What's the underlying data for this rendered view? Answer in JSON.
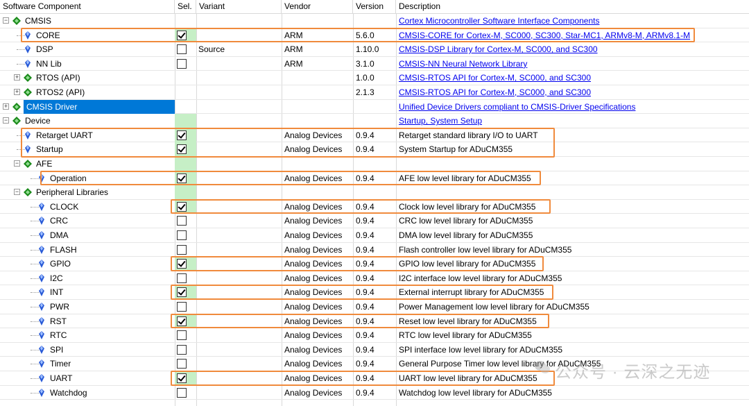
{
  "header": {
    "component": "Software Component",
    "sel": "Sel.",
    "variant": "Variant",
    "vendor": "Vendor",
    "version": "Version",
    "description": "Description"
  },
  "rows": [
    {
      "name": "CMSIS",
      "level": 0,
      "toggle": "-",
      "icon": "diamond-icon",
      "checkbox": false,
      "sel_state": "none",
      "variant": "",
      "vendor": "",
      "version": "",
      "desc": "Cortex Microcontroller Software Interface Components",
      "link": true,
      "green": false,
      "highlight": false,
      "selected": false
    },
    {
      "name": "CORE",
      "level": 1,
      "toggle": "",
      "icon": "gem-icon",
      "checkbox": true,
      "sel_state": "checked",
      "variant": "",
      "vendor": "ARM",
      "version": "5.6.0",
      "desc": "CMSIS-CORE for Cortex-M, SC000, SC300, Star-MC1, ARMv8-M, ARMv8.1-M",
      "link": true,
      "green": true,
      "highlight": true,
      "selected": false
    },
    {
      "name": "DSP",
      "level": 1,
      "toggle": "",
      "icon": "gem-icon",
      "checkbox": true,
      "sel_state": "unchecked",
      "variant": "Source",
      "vendor": "ARM",
      "version": "1.10.0",
      "desc": "CMSIS-DSP Library for Cortex-M, SC000, and SC300",
      "link": true,
      "green": false,
      "highlight": false,
      "selected": false
    },
    {
      "name": "NN Lib",
      "level": 1,
      "toggle": "",
      "icon": "gem-icon",
      "checkbox": true,
      "sel_state": "unchecked",
      "variant": "",
      "vendor": "ARM",
      "version": "3.1.0",
      "desc": "CMSIS-NN Neural Network Library",
      "link": true,
      "green": false,
      "highlight": false,
      "selected": false
    },
    {
      "name": "RTOS (API)",
      "level": 1,
      "toggle": "+",
      "icon": "diamond-icon",
      "checkbox": false,
      "sel_state": "none",
      "variant": "",
      "vendor": "",
      "version": "1.0.0",
      "desc": "CMSIS-RTOS API for Cortex-M, SC000, and SC300",
      "link": true,
      "green": false,
      "highlight": false,
      "selected": false
    },
    {
      "name": "RTOS2 (API)",
      "level": 1,
      "toggle": "+",
      "icon": "diamond-icon",
      "checkbox": false,
      "sel_state": "none",
      "variant": "",
      "vendor": "",
      "version": "2.1.3",
      "desc": "CMSIS-RTOS API for Cortex-M, SC000, and SC300",
      "link": true,
      "green": false,
      "highlight": false,
      "selected": false
    },
    {
      "name": "CMSIS Driver",
      "level": 0,
      "toggle": "+",
      "icon": "diamond-icon",
      "checkbox": false,
      "sel_state": "none",
      "variant": "",
      "vendor": "",
      "version": "",
      "desc": "Unified Device Drivers compliant to CMSIS-Driver Specifications",
      "link": true,
      "green": false,
      "highlight": false,
      "selected": true
    },
    {
      "name": "Device",
      "level": 0,
      "toggle": "-",
      "icon": "diamond-icon",
      "checkbox": false,
      "sel_state": "none",
      "variant": "",
      "vendor": "",
      "version": "",
      "desc": "Startup, System Setup",
      "link": true,
      "green": true,
      "highlight": false,
      "selected": false
    },
    {
      "name": "Retarget UART",
      "level": 1,
      "toggle": "",
      "icon": "gem-icon",
      "checkbox": true,
      "sel_state": "checked",
      "variant": "",
      "vendor": "Analog Devices",
      "version": "0.9.4",
      "desc": "Retarget standard library I/O to UART",
      "link": false,
      "green": true,
      "highlight": true,
      "selected": false
    },
    {
      "name": "Startup",
      "level": 1,
      "toggle": "",
      "icon": "gem-icon",
      "checkbox": true,
      "sel_state": "checked",
      "variant": "",
      "vendor": "Analog Devices",
      "version": "0.9.4",
      "desc": "System Startup for ADuCM355",
      "link": false,
      "green": true,
      "highlight": true,
      "selected": false
    },
    {
      "name": "AFE",
      "level": 1,
      "toggle": "-",
      "icon": "diamond-icon",
      "checkbox": false,
      "sel_state": "none",
      "variant": "",
      "vendor": "",
      "version": "",
      "desc": "",
      "link": false,
      "green": true,
      "highlight": false,
      "selected": false
    },
    {
      "name": "Operation",
      "level": 2,
      "toggle": "",
      "icon": "gem-icon",
      "checkbox": true,
      "sel_state": "checked",
      "variant": "",
      "vendor": "Analog Devices",
      "version": "0.9.4",
      "desc": "AFE low level library for ADuCM355",
      "link": false,
      "green": true,
      "highlight": true,
      "selected": false
    },
    {
      "name": "Peripheral Libraries",
      "level": 1,
      "toggle": "-",
      "icon": "diamond-icon",
      "checkbox": false,
      "sel_state": "none",
      "variant": "",
      "vendor": "",
      "version": "",
      "desc": "",
      "link": false,
      "green": true,
      "highlight": false,
      "selected": false
    },
    {
      "name": "CLOCK",
      "level": 2,
      "toggle": "",
      "icon": "gem-icon",
      "checkbox": true,
      "sel_state": "checked",
      "variant": "",
      "vendor": "Analog Devices",
      "version": "0.9.4",
      "desc": "Clock low level library for ADuCM355",
      "link": false,
      "green": true,
      "highlight": true,
      "selected": false
    },
    {
      "name": "CRC",
      "level": 2,
      "toggle": "",
      "icon": "gem-icon",
      "checkbox": true,
      "sel_state": "unchecked",
      "variant": "",
      "vendor": "Analog Devices",
      "version": "0.9.4",
      "desc": "CRC low level library for ADuCM355",
      "link": false,
      "green": false,
      "highlight": false,
      "selected": false
    },
    {
      "name": "DMA",
      "level": 2,
      "toggle": "",
      "icon": "gem-icon",
      "checkbox": true,
      "sel_state": "unchecked",
      "variant": "",
      "vendor": "Analog Devices",
      "version": "0.9.4",
      "desc": "DMA low level library for ADuCM355",
      "link": false,
      "green": false,
      "highlight": false,
      "selected": false
    },
    {
      "name": "FLASH",
      "level": 2,
      "toggle": "",
      "icon": "gem-icon",
      "checkbox": true,
      "sel_state": "unchecked",
      "variant": "",
      "vendor": "Analog Devices",
      "version": "0.9.4",
      "desc": "Flash controller low level library for ADuCM355",
      "link": false,
      "green": false,
      "highlight": false,
      "selected": false
    },
    {
      "name": "GPIO",
      "level": 2,
      "toggle": "",
      "icon": "gem-icon",
      "checkbox": true,
      "sel_state": "checked",
      "variant": "",
      "vendor": "Analog Devices",
      "version": "0.9.4",
      "desc": "GPIO low level library for ADuCM355",
      "link": false,
      "green": true,
      "highlight": true,
      "selected": false
    },
    {
      "name": "I2C",
      "level": 2,
      "toggle": "",
      "icon": "gem-icon",
      "checkbox": true,
      "sel_state": "unchecked",
      "variant": "",
      "vendor": "Analog Devices",
      "version": "0.9.4",
      "desc": "I2C interface low level library for ADuCM355",
      "link": false,
      "green": false,
      "highlight": false,
      "selected": false
    },
    {
      "name": "INT",
      "level": 2,
      "toggle": "",
      "icon": "gem-icon",
      "checkbox": true,
      "sel_state": "checked",
      "variant": "",
      "vendor": "Analog Devices",
      "version": "0.9.4",
      "desc": "External interrupt library for ADuCM355",
      "link": false,
      "green": true,
      "highlight": true,
      "selected": false
    },
    {
      "name": "PWR",
      "level": 2,
      "toggle": "",
      "icon": "gem-icon",
      "checkbox": true,
      "sel_state": "unchecked",
      "variant": "",
      "vendor": "Analog Devices",
      "version": "0.9.4",
      "desc": "Power Management low level library for ADuCM355",
      "link": false,
      "green": false,
      "highlight": false,
      "selected": false
    },
    {
      "name": "RST",
      "level": 2,
      "toggle": "",
      "icon": "gem-icon",
      "checkbox": true,
      "sel_state": "checked",
      "variant": "",
      "vendor": "Analog Devices",
      "version": "0.9.4",
      "desc": "Reset low level library for ADuCM355",
      "link": false,
      "green": true,
      "highlight": true,
      "selected": false
    },
    {
      "name": "RTC",
      "level": 2,
      "toggle": "",
      "icon": "gem-icon",
      "checkbox": true,
      "sel_state": "unchecked",
      "variant": "",
      "vendor": "Analog Devices",
      "version": "0.9.4",
      "desc": "RTC low level library for ADuCM355",
      "link": false,
      "green": false,
      "highlight": false,
      "selected": false
    },
    {
      "name": "SPI",
      "level": 2,
      "toggle": "",
      "icon": "gem-icon",
      "checkbox": true,
      "sel_state": "unchecked",
      "variant": "",
      "vendor": "Analog Devices",
      "version": "0.9.4",
      "desc": "SPI interface low level library for ADuCM355",
      "link": false,
      "green": false,
      "highlight": false,
      "selected": false
    },
    {
      "name": "Timer",
      "level": 2,
      "toggle": "",
      "icon": "gem-icon",
      "checkbox": true,
      "sel_state": "unchecked",
      "variant": "",
      "vendor": "Analog Devices",
      "version": "0.9.4",
      "desc": "General Purpose Timer low level library for ADuCM355",
      "link": false,
      "green": false,
      "highlight": false,
      "selected": false
    },
    {
      "name": "UART",
      "level": 2,
      "toggle": "",
      "icon": "gem-icon",
      "checkbox": true,
      "sel_state": "checked",
      "variant": "",
      "vendor": "Analog Devices",
      "version": "0.9.4",
      "desc": "UART low level library for ADuCM355",
      "link": false,
      "green": true,
      "highlight": true,
      "selected": false
    },
    {
      "name": "Watchdog",
      "level": 2,
      "toggle": "",
      "icon": "gem-icon",
      "checkbox": true,
      "sel_state": "unchecked",
      "variant": "",
      "vendor": "Analog Devices",
      "version": "0.9.4",
      "desc": "Watchdog low level library for ADuCM355",
      "link": false,
      "green": false,
      "highlight": false,
      "selected": false
    }
  ],
  "watermark": "公众号 · 云深之无迹",
  "colors": {
    "highlight_border": "#f08a3c",
    "selected_bg": "#0078d7",
    "sel_green": "#c6efc6",
    "link": "#0000ee",
    "diamond_green": "#1a8a1a",
    "gem_blue": "#2a5bd7"
  }
}
